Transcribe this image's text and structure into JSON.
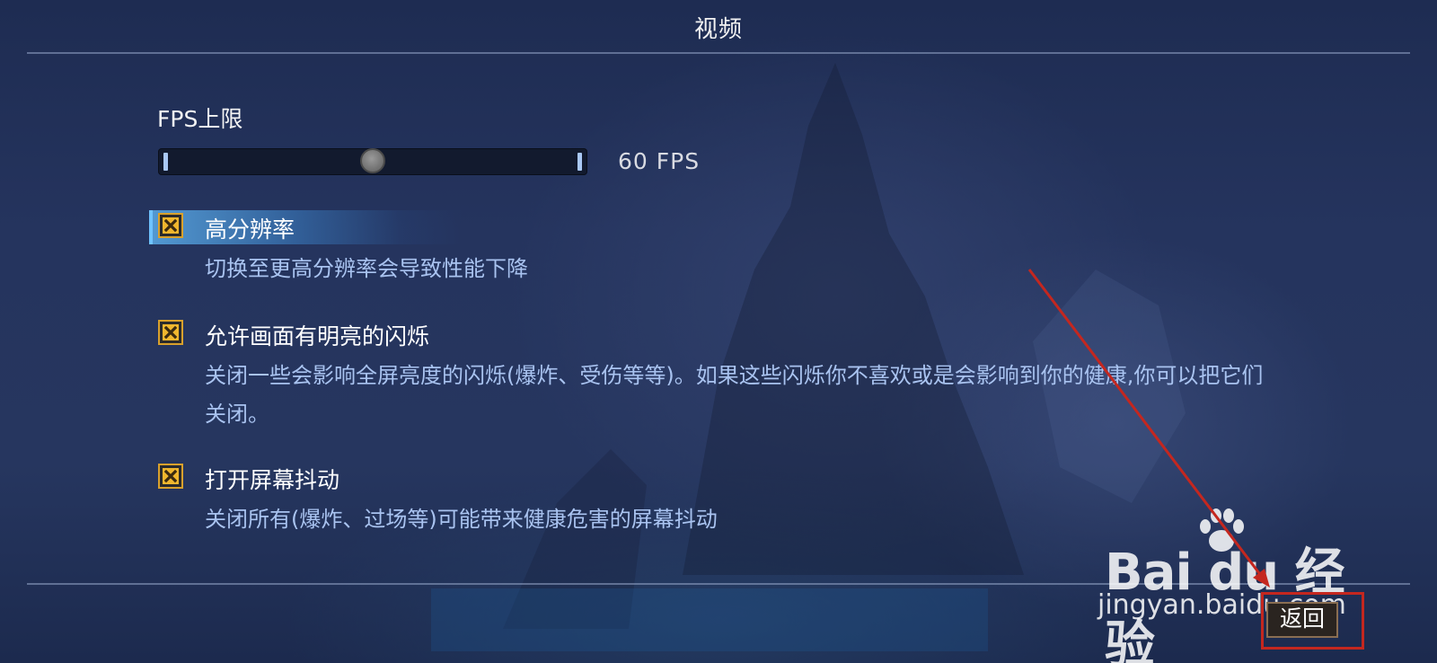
{
  "screen": {
    "title": "视频"
  },
  "fps_limit": {
    "label": "FPS上限",
    "value_text": "60 FPS",
    "slider_level": 0.5
  },
  "options": [
    {
      "label": "高分辨率",
      "description": "切换至更高分辨率会导致性能下降",
      "checked": true,
      "highlighted": true
    },
    {
      "label": "允许画面有明亮的闪烁",
      "description": "关闭一些会影响全屏亮度的闪烁(爆炸、受伤等等)。如果这些闪烁你不喜欢或是会影响到你的健康,你可以把它们关闭。",
      "checked": true,
      "highlighted": false
    },
    {
      "label": "打开屏幕抖动",
      "description": "关闭所有(爆炸、过场等)可能带来健康危害的屏幕抖动",
      "checked": true,
      "highlighted": false
    }
  ],
  "footer": {
    "back_label": "返回"
  },
  "watermark": {
    "brand": "Bai du 经验",
    "url": "jingyan.baidu.com"
  },
  "colors": {
    "accent": "#6fc3ff",
    "checkbox": "#f0b62e",
    "description_text": "#a9c3f0",
    "annotation": "#c4271f"
  }
}
